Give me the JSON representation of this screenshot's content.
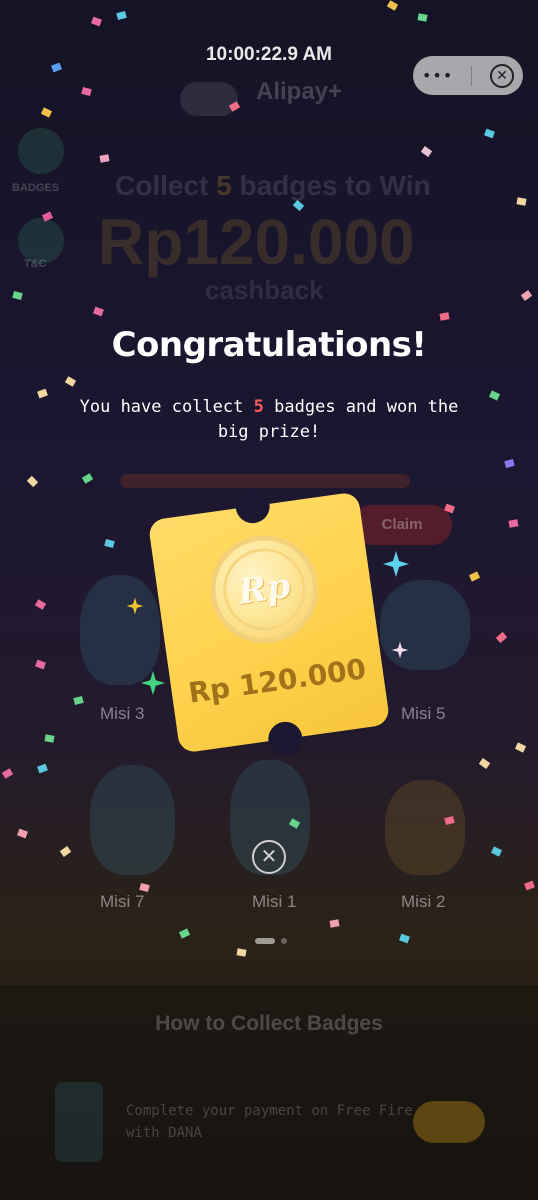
{
  "status_bar": {
    "time": "10:00:22.9 AM"
  },
  "mini_program_menu": {
    "more_glyph": "•••",
    "close_glyph": "✕"
  },
  "background": {
    "brand": "Alipay+",
    "sidebar": [
      {
        "label": "BADGES",
        "icon": "badge-icon"
      },
      {
        "label": "T&C",
        "icon": "document-icon"
      }
    ],
    "headline": {
      "prefix": "Collect",
      "number": "5",
      "suffix": "badges to Win"
    },
    "prize_big": "Rp120.000",
    "prize_sub": "cashback",
    "claim_label": "Claim",
    "missions": [
      "Misi 3",
      "Misi 5",
      "Misi 7",
      "Misi 1",
      "Misi 2"
    ],
    "how_title": "How to Collect Badges",
    "how_step": "Complete your payment on Free Fire with DANA"
  },
  "modal": {
    "title": "Congratulations!",
    "message_before": "You have collect",
    "badge_count": "5",
    "message_after": "badges and won the big prize!",
    "coin_symbol": "Rp",
    "prize_amount": "Rp 120.000",
    "close_glyph": "✕"
  },
  "colors": {
    "highlight_red": "#ff5a5a",
    "ticket_yellow": "#ffd24d",
    "amount_text": "#a2721a"
  }
}
